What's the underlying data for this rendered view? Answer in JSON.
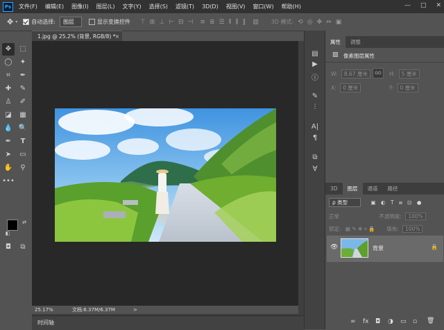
{
  "menubar": {
    "logo": "Ps",
    "items": [
      "文件(F)",
      "编辑(E)",
      "图像(I)",
      "图层(L)",
      "文字(Y)",
      "选择(S)",
      "滤镜(T)",
      "3D(D)",
      "视图(V)",
      "窗口(W)",
      "帮助(H)"
    ],
    "window_controls": [
      "—",
      "□",
      "✕"
    ]
  },
  "options": {
    "auto_select_label": "自动选择:",
    "auto_select_value": "图层",
    "show_transform_label": "显示变换控件",
    "mode3d_label": "3D 模式:"
  },
  "document": {
    "tab_title": "1.jpg @ 25.2% (背景, RGB/8) *",
    "tab_close": "×",
    "zoom_status": "25.17%",
    "doc_size": "文档:6.37M/6.37M",
    "status_arrow": ">"
  },
  "timeline": {
    "label": "时间轴"
  },
  "properties_panel": {
    "tabs": [
      "属性",
      "调整"
    ],
    "title": "像素图层属性",
    "w_label": "W:",
    "w_value": "8.67 厘米",
    "h_label": "H:",
    "h_value": "5 厘米",
    "x_label": "X:",
    "x_value": "0 厘米",
    "y_label": "Y:",
    "y_value": "0 厘米",
    "link_icon": "GO"
  },
  "layers_panel": {
    "tabs": [
      "3D",
      "图层",
      "通道",
      "路径"
    ],
    "filter_value": "ρ 类型",
    "blend_mode": "正常",
    "opacity_label": "不透明度:",
    "opacity_value": "100%",
    "lock_label": "锁定:",
    "fill_label": "填充:",
    "fill_value": "100%",
    "layer_name": "背景",
    "footer_icons": [
      "∞",
      "fx",
      "◘",
      "◑",
      "▭",
      "▫",
      "🗑"
    ]
  },
  "colors": {
    "menubar_bg": "#323232",
    "panel_bg": "#535353",
    "canvas_bg": "#282828",
    "accent": "#31a8ff"
  }
}
